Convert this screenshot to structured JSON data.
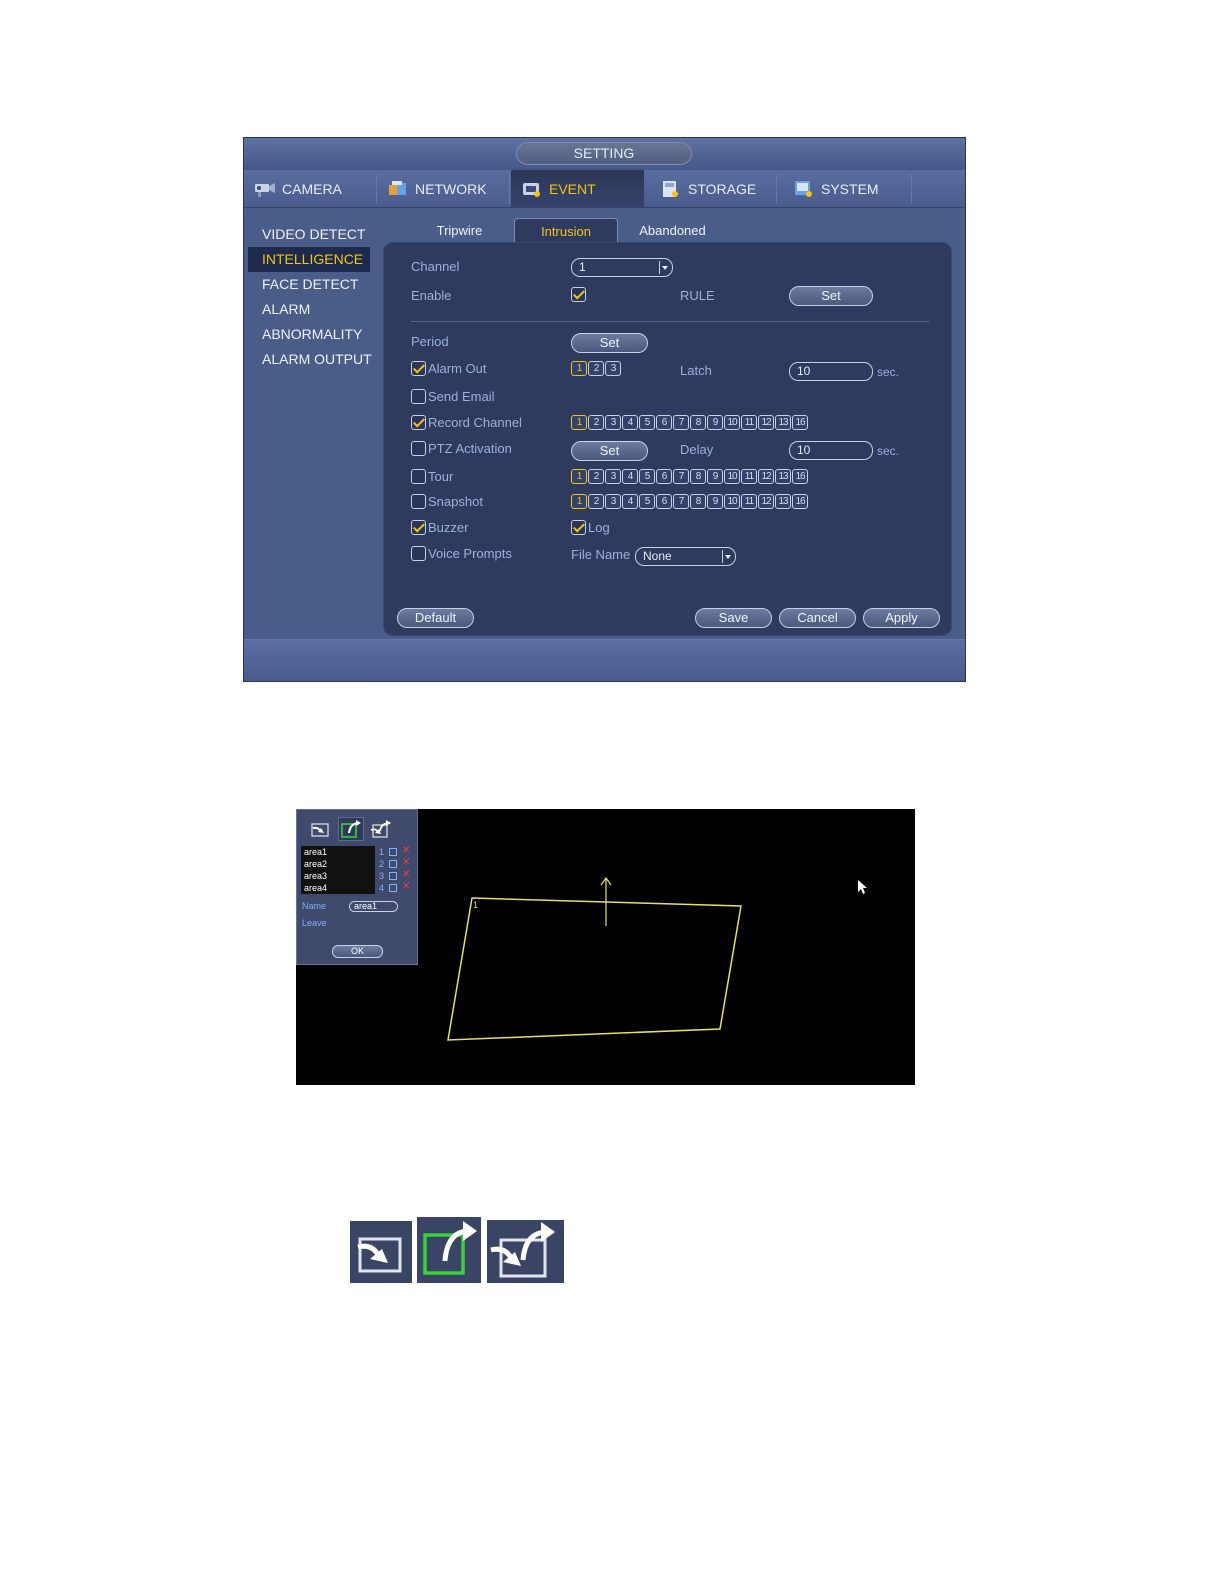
{
  "window": {
    "title": "SETTING"
  },
  "main_tabs": [
    {
      "label": "CAMERA",
      "icon": "camera-icon"
    },
    {
      "label": "NETWORK",
      "icon": "network-icon"
    },
    {
      "label": "EVENT",
      "icon": "event-icon",
      "active": true
    },
    {
      "label": "STORAGE",
      "icon": "storage-icon"
    },
    {
      "label": "SYSTEM",
      "icon": "system-icon"
    }
  ],
  "side_menu": [
    {
      "label": "VIDEO DETECT"
    },
    {
      "label": "INTELLIGENCE",
      "active": true
    },
    {
      "label": "FACE DETECT"
    },
    {
      "label": "ALARM"
    },
    {
      "label": "ABNORMALITY"
    },
    {
      "label": "ALARM OUTPUT"
    }
  ],
  "sub_tabs": [
    {
      "label": "Tripwire"
    },
    {
      "label": "Intrusion",
      "active": true
    },
    {
      "label": "Abandoned"
    }
  ],
  "form": {
    "channel_label": "Channel",
    "channel_value": "1",
    "enable_label": "Enable",
    "enable_checked": true,
    "rule_label": "RULE",
    "rule_button": "Set",
    "period_label": "Period",
    "period_button": "Set",
    "alarm_out_label": "Alarm Out",
    "alarm_out_checked": true,
    "alarm_out_channels": [
      "1",
      "2",
      "3"
    ],
    "latch_label": "Latch",
    "latch_value": "10",
    "latch_unit": "sec.",
    "send_email_label": "Send Email",
    "send_email_checked": false,
    "record_channel_label": "Record Channel",
    "record_channel_checked": true,
    "ptz_label": "PTZ Activation",
    "ptz_checked": false,
    "ptz_button": "Set",
    "delay_label": "Delay",
    "delay_value": "10",
    "delay_unit": "sec.",
    "tour_label": "Tour",
    "tour_checked": false,
    "snapshot_label": "Snapshot",
    "snapshot_checked": false,
    "buzzer_label": "Buzzer",
    "buzzer_checked": true,
    "log_label": "Log",
    "log_checked": true,
    "voice_prompts_label": "Voice Prompts",
    "voice_prompts_checked": false,
    "file_name_label": "File Name",
    "file_name_value": "None",
    "channels_16": [
      "1",
      "2",
      "3",
      "4",
      "5",
      "6",
      "7",
      "8",
      "9",
      "10",
      "11",
      "12",
      "13",
      "16"
    ]
  },
  "footer_buttons": {
    "default": "Default",
    "save": "Save",
    "cancel": "Cancel",
    "apply": "Apply"
  },
  "draw_panel": {
    "areas": [
      {
        "name": "area1",
        "num": "1"
      },
      {
        "name": "area2",
        "num": "2"
      },
      {
        "name": "area3",
        "num": "3"
      },
      {
        "name": "area4",
        "num": "4"
      }
    ],
    "name_label": "Name",
    "name_value": "area1",
    "leave_label": "Leave",
    "ok_button": "OK",
    "region_label": "1"
  },
  "colors": {
    "accent": "#f2c418",
    "panel": "#2e3a5e",
    "window": "#4a5c88",
    "region_line": "#e8e060",
    "selected_tool": "#3ad13a"
  }
}
